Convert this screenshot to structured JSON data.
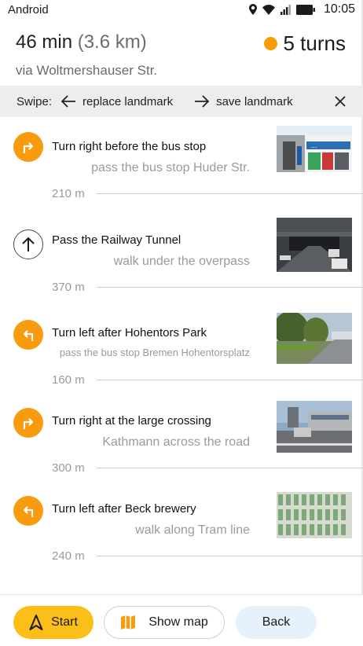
{
  "status_bar": {
    "app_name": "Android",
    "time": "10:05"
  },
  "summary": {
    "duration": "46 min",
    "distance": "(3.6 km)",
    "turns": "5 turns",
    "via": "via Woltmershauser Str.",
    "turns_color": "#f59c06"
  },
  "swipe": {
    "label": "Swipe:",
    "left_action": "replace landmark",
    "right_action": "save landmark"
  },
  "steps": [
    {
      "icon": "turn-right-icon",
      "title": "Turn right before the bus stop",
      "subtitle": "pass the bus stop Huder Str.",
      "distance": "210 m",
      "photo": "bus-stop-photo"
    },
    {
      "icon": "straight-arrow-icon",
      "title": "Pass the Railway Tunnel",
      "subtitle": "walk under the overpass",
      "distance": "370 m",
      "photo": "railway-tunnel-photo"
    },
    {
      "icon": "turn-left-icon",
      "title": "Turn left after Hohentors Park",
      "subtitle": "pass the bus stop Bremen Hohentorsplatz",
      "distance": "160 m",
      "photo": "park-photo"
    },
    {
      "icon": "turn-right-icon",
      "title": "Turn right at the large crossing",
      "subtitle": "Kathmann across the road",
      "distance": "300 m",
      "photo": "crossing-photo"
    },
    {
      "icon": "turn-left-icon",
      "title": "Turn left after Beck brewery",
      "subtitle": "walk along Tram line",
      "distance": "240 m",
      "photo": "brewery-photo"
    }
  ],
  "buttons": {
    "start": "Start",
    "show_map": "Show map",
    "back": "Back"
  },
  "colors": {
    "accent": "#f89b0c",
    "start_button": "#fbbf17",
    "back_button": "#e7f1fb"
  }
}
